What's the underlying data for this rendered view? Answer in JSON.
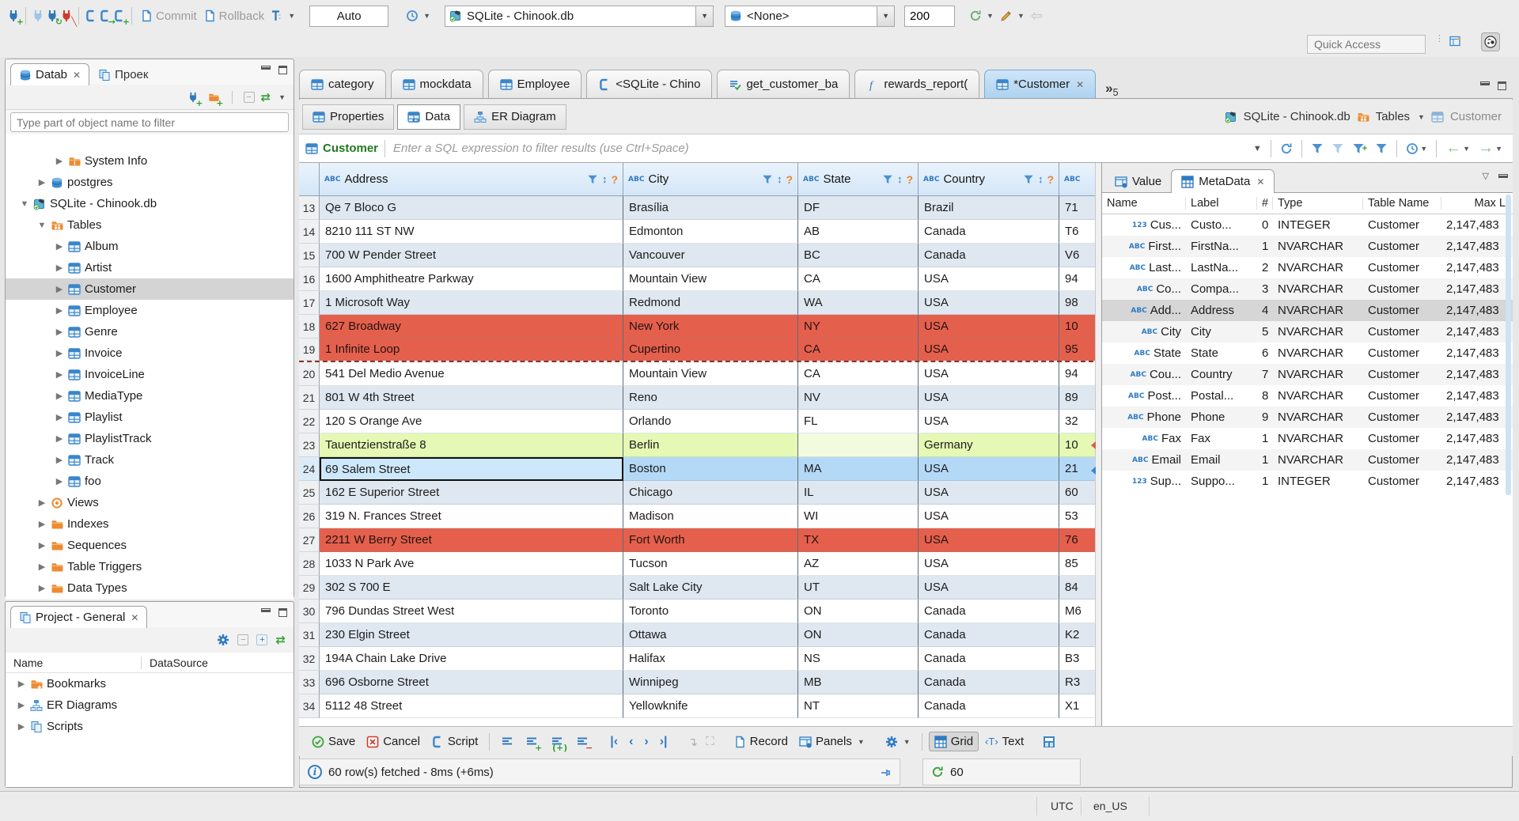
{
  "window": {
    "quick_access_placeholder": "Quick Access",
    "timezone": "UTC",
    "locale": "en_US"
  },
  "toolbar": {
    "commit_label": "Commit",
    "rollback_label": "Rollback",
    "txn_mode": "Auto",
    "connection": "SQLite - Chinook.db",
    "schema": "<None>",
    "fetch_size": "200"
  },
  "navigator": {
    "tab_db": "Datab",
    "tab_project": "Проек",
    "filter_placeholder": "Type part of object name to filter",
    "tree": [
      {
        "label": "System Info",
        "icon": "folder-info",
        "depth": 3,
        "arrow": "right"
      },
      {
        "label": "postgres",
        "icon": "db",
        "depth": 2,
        "arrow": "right"
      },
      {
        "label": "SQLite - Chinook.db",
        "icon": "sqlite",
        "depth": 1,
        "arrow": "down"
      },
      {
        "label": "Tables",
        "icon": "folder-table",
        "depth": 2,
        "arrow": "down"
      },
      {
        "label": "Album",
        "icon": "table",
        "depth": 3,
        "arrow": "right"
      },
      {
        "label": "Artist",
        "icon": "table",
        "depth": 3,
        "arrow": "right"
      },
      {
        "label": "Customer",
        "icon": "table",
        "depth": 3,
        "arrow": "right",
        "selected": true
      },
      {
        "label": "Employee",
        "icon": "table",
        "depth": 3,
        "arrow": "right"
      },
      {
        "label": "Genre",
        "icon": "table",
        "depth": 3,
        "arrow": "right"
      },
      {
        "label": "Invoice",
        "icon": "table",
        "depth": 3,
        "arrow": "right"
      },
      {
        "label": "InvoiceLine",
        "icon": "table",
        "depth": 3,
        "arrow": "right"
      },
      {
        "label": "MediaType",
        "icon": "table",
        "depth": 3,
        "arrow": "right"
      },
      {
        "label": "Playlist",
        "icon": "table",
        "depth": 3,
        "arrow": "right"
      },
      {
        "label": "PlaylistTrack",
        "icon": "table",
        "depth": 3,
        "arrow": "right"
      },
      {
        "label": "Track",
        "icon": "table",
        "depth": 3,
        "arrow": "right"
      },
      {
        "label": "foo",
        "icon": "table",
        "depth": 3,
        "arrow": "right"
      },
      {
        "label": "Views",
        "icon": "eye",
        "depth": 2,
        "arrow": "right"
      },
      {
        "label": "Indexes",
        "icon": "folder",
        "depth": 2,
        "arrow": "right"
      },
      {
        "label": "Sequences",
        "icon": "folder",
        "depth": 2,
        "arrow": "right"
      },
      {
        "label": "Table Triggers",
        "icon": "folder",
        "depth": 2,
        "arrow": "right"
      },
      {
        "label": "Data Types",
        "icon": "folder",
        "depth": 2,
        "arrow": "right"
      }
    ]
  },
  "project": {
    "title": "Project - General",
    "col_name": "Name",
    "col_datasource": "DataSource",
    "items": [
      {
        "label": "Bookmarks",
        "icon": "folder-star"
      },
      {
        "label": "ER Diagrams",
        "icon": "erd"
      },
      {
        "label": "Scripts",
        "icon": "scripts"
      }
    ]
  },
  "editor": {
    "tabs": [
      {
        "label": "category",
        "icon": "table"
      },
      {
        "label": "mockdata",
        "icon": "table"
      },
      {
        "label": "Employee",
        "icon": "table"
      },
      {
        "label": "<SQLite - Chino",
        "icon": "script"
      },
      {
        "label": "get_customer_ba",
        "icon": "script-check"
      },
      {
        "label": "rewards_report(",
        "icon": "fx"
      },
      {
        "label": "*Customer",
        "icon": "table",
        "active": true,
        "close": true
      }
    ],
    "overflow_count": "5",
    "subtabs": [
      {
        "label": "Properties",
        "icon": "table"
      },
      {
        "label": "Data",
        "icon": "table-code",
        "active": true
      },
      {
        "label": "ER Diagram",
        "icon": "erd"
      }
    ],
    "breadcrumb": {
      "connection": "SQLite - Chinook.db",
      "container": "Tables",
      "entity": "Customer"
    },
    "filter_entity": "Customer",
    "filter_placeholder": "Enter a SQL expression to filter results (use Ctrl+Space)"
  },
  "grid": {
    "columns": [
      "Address",
      "City",
      "State",
      "Country"
    ],
    "rows": [
      {
        "num": "13",
        "address": "Qe 7 Bloco G",
        "city": "Brasília",
        "state": "DF",
        "country": "Brazil",
        "postal": "71",
        "style": "odd"
      },
      {
        "num": "14",
        "address": "8210 111 ST NW",
        "city": "Edmonton",
        "state": "AB",
        "country": "Canada",
        "postal": "T6",
        "style": "even"
      },
      {
        "num": "15",
        "address": "700 W Pender Street",
        "city": "Vancouver",
        "state": "BC",
        "country": "Canada",
        "postal": "V6",
        "style": "odd"
      },
      {
        "num": "16",
        "address": "1600 Amphitheatre Parkway",
        "city": "Mountain View",
        "state": "CA",
        "country": "USA",
        "postal": "94",
        "style": "even"
      },
      {
        "num": "17",
        "address": "1 Microsoft Way",
        "city": "Redmond",
        "state": "WA",
        "country": "USA",
        "postal": "98",
        "style": "odd"
      },
      {
        "num": "18",
        "address": "627 Broadway",
        "city": "New York",
        "state": "NY",
        "country": "USA",
        "postal": "10",
        "style": "deleted"
      },
      {
        "num": "19",
        "address": "1 Infinite Loop",
        "city": "Cupertino",
        "state": "CA",
        "country": "USA",
        "postal": "95",
        "style": "deleted",
        "torn": true
      },
      {
        "num": "20",
        "address": "541 Del Medio Avenue",
        "city": "Mountain View",
        "state": "CA",
        "country": "USA",
        "postal": "94",
        "style": "even"
      },
      {
        "num": "21",
        "address": "801 W 4th Street",
        "city": "Reno",
        "state": "NV",
        "country": "USA",
        "postal": "89",
        "style": "odd"
      },
      {
        "num": "22",
        "address": "120 S Orange Ave",
        "city": "Orlando",
        "state": "FL",
        "country": "USA",
        "postal": "32",
        "style": "even"
      },
      {
        "num": "23",
        "address": "Tauentzienstraße 8",
        "city": "Berlin",
        "state": "",
        "country": "Germany",
        "postal": "10",
        "style": "new"
      },
      {
        "num": "24",
        "address": "69 Salem Street",
        "city": "Boston",
        "state": "MA",
        "country": "USA",
        "postal": "21",
        "style": "selected"
      },
      {
        "num": "25",
        "address": "162 E Superior Street",
        "city": "Chicago",
        "state": "IL",
        "country": "USA",
        "postal": "60",
        "style": "odd"
      },
      {
        "num": "26",
        "address": "319 N. Frances Street",
        "city": "Madison",
        "state": "WI",
        "country": "USA",
        "postal": "53",
        "style": "even"
      },
      {
        "num": "27",
        "address": "2211 W Berry Street",
        "city": "Fort Worth",
        "state": "TX",
        "country": "USA",
        "postal": "76",
        "style": "deleted"
      },
      {
        "num": "28",
        "address": "1033 N Park Ave",
        "city": "Tucson",
        "state": "AZ",
        "country": "USA",
        "postal": "85",
        "style": "even"
      },
      {
        "num": "29",
        "address": "302 S 700 E",
        "city": "Salt Lake City",
        "state": "UT",
        "country": "USA",
        "postal": "84",
        "style": "odd"
      },
      {
        "num": "30",
        "address": "796 Dundas Street West",
        "city": "Toronto",
        "state": "ON",
        "country": "Canada",
        "postal": "M6",
        "style": "even"
      },
      {
        "num": "31",
        "address": "230 Elgin Street",
        "city": "Ottawa",
        "state": "ON",
        "country": "Canada",
        "postal": "K2",
        "style": "odd"
      },
      {
        "num": "32",
        "address": "194A Chain Lake Drive",
        "city": "Halifax",
        "state": "NS",
        "country": "Canada",
        "postal": "B3",
        "style": "even"
      },
      {
        "num": "33",
        "address": "696 Osborne Street",
        "city": "Winnipeg",
        "state": "MB",
        "country": "Canada",
        "postal": "R3",
        "style": "odd"
      },
      {
        "num": "34",
        "address": "5112 48 Street",
        "city": "Yellowknife",
        "state": "NT",
        "country": "Canada",
        "postal": "X1",
        "style": "even"
      }
    ]
  },
  "panel": {
    "tab_value": "Value",
    "tab_metadata": "MetaData",
    "columns": [
      "Name",
      "Label",
      "#",
      "Type",
      "Table Name",
      "Max L"
    ],
    "rows": [
      {
        "icon": "123",
        "name": "Cus...",
        "label": "Custo...",
        "num": "0",
        "type": "INTEGER",
        "table": "Customer",
        "max": "2,147,483"
      },
      {
        "icon": "abc",
        "name": "First...",
        "label": "FirstNa...",
        "num": "1",
        "type": "NVARCHAR",
        "table": "Customer",
        "max": "2,147,483"
      },
      {
        "icon": "abc",
        "name": "Last...",
        "label": "LastNa...",
        "num": "2",
        "type": "NVARCHAR",
        "table": "Customer",
        "max": "2,147,483"
      },
      {
        "icon": "abc",
        "name": "Co...",
        "label": "Compa...",
        "num": "3",
        "type": "NVARCHAR",
        "table": "Customer",
        "max": "2,147,483"
      },
      {
        "icon": "abc",
        "name": "Add...",
        "label": "Address",
        "num": "4",
        "type": "NVARCHAR",
        "table": "Customer",
        "max": "2,147,483",
        "selected": true
      },
      {
        "icon": "abc",
        "name": "City",
        "label": "City",
        "num": "5",
        "type": "NVARCHAR",
        "table": "Customer",
        "max": "2,147,483"
      },
      {
        "icon": "abc",
        "name": "State",
        "label": "State",
        "num": "6",
        "type": "NVARCHAR",
        "table": "Customer",
        "max": "2,147,483"
      },
      {
        "icon": "abc",
        "name": "Cou...",
        "label": "Country",
        "num": "7",
        "type": "NVARCHAR",
        "table": "Customer",
        "max": "2,147,483"
      },
      {
        "icon": "abc",
        "name": "Post...",
        "label": "Postal...",
        "num": "8",
        "type": "NVARCHAR",
        "table": "Customer",
        "max": "2,147,483"
      },
      {
        "icon": "abc",
        "name": "Phone",
        "label": "Phone",
        "num": "9",
        "type": "NVARCHAR",
        "table": "Customer",
        "max": "2,147,483"
      },
      {
        "icon": "abc",
        "name": "Fax",
        "label": "Fax",
        "num": "1",
        "type": "NVARCHAR",
        "table": "Customer",
        "max": "2,147,483"
      },
      {
        "icon": "abc",
        "name": "Email",
        "label": "Email",
        "num": "1",
        "type": "NVARCHAR",
        "table": "Customer",
        "max": "2,147,483"
      },
      {
        "icon": "123",
        "name": "Sup...",
        "label": "Suppo...",
        "num": "1",
        "type": "INTEGER",
        "table": "Customer",
        "max": "2,147,483"
      }
    ]
  },
  "footer": {
    "save": "Save",
    "cancel": "Cancel",
    "script": "Script",
    "record": "Record",
    "panels": "Panels",
    "grid": "Grid",
    "text": "Text",
    "status": "60 row(s) fetched - 8ms (+6ms)",
    "refresh_value": "60"
  }
}
